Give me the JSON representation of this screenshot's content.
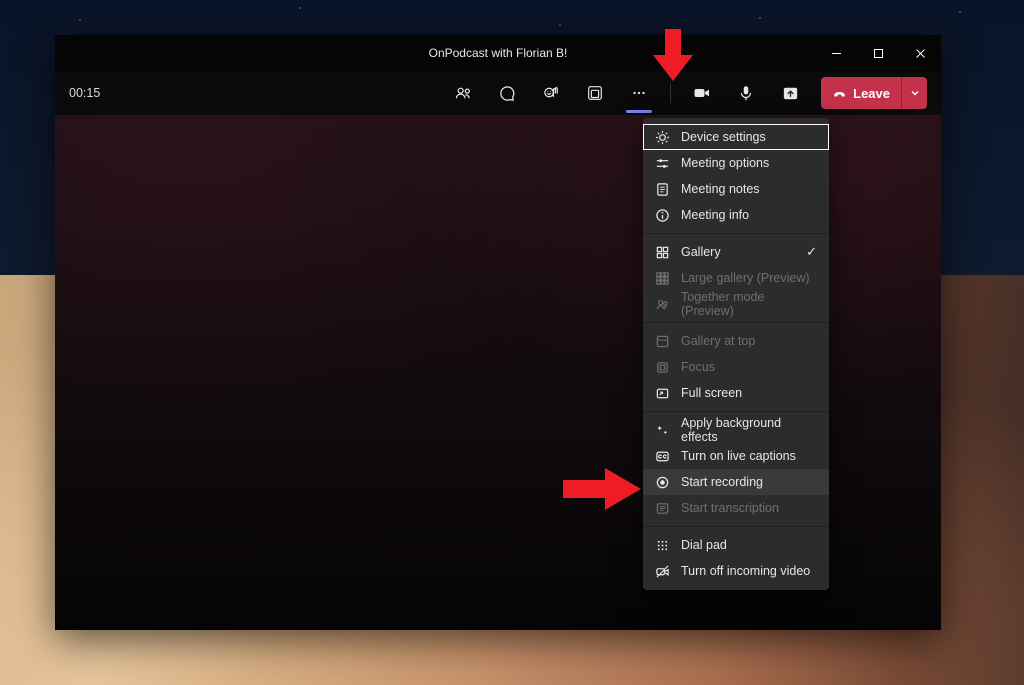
{
  "titlebar": {
    "title": "OnPodcast with Florian B!"
  },
  "toolbar": {
    "timer": "00:15",
    "leave_label": "Leave"
  },
  "menu": {
    "groups": [
      [
        {
          "key": "device_settings",
          "label": "Device settings",
          "icon": "gear",
          "selected": true
        },
        {
          "key": "meeting_options",
          "label": "Meeting options",
          "icon": "sliders"
        },
        {
          "key": "meeting_notes",
          "label": "Meeting notes",
          "icon": "notes"
        },
        {
          "key": "meeting_info",
          "label": "Meeting info",
          "icon": "info"
        }
      ],
      [
        {
          "key": "gallery",
          "label": "Gallery",
          "icon": "grid",
          "checked": true
        },
        {
          "key": "large_gallery",
          "label": "Large gallery (Preview)",
          "icon": "grid-large",
          "disabled": true
        },
        {
          "key": "together_mode",
          "label": "Together mode (Preview)",
          "icon": "people",
          "disabled": true
        }
      ],
      [
        {
          "key": "gallery_at_top",
          "label": "Gallery at top",
          "icon": "layout-top",
          "disabled": true
        },
        {
          "key": "focus",
          "label": "Focus",
          "icon": "frame",
          "disabled": true
        },
        {
          "key": "full_screen",
          "label": "Full screen",
          "icon": "fullscreen"
        }
      ],
      [
        {
          "key": "apply_bg",
          "label": "Apply background effects",
          "icon": "sparkle"
        },
        {
          "key": "live_captions",
          "label": "Turn on live captions",
          "icon": "cc"
        },
        {
          "key": "start_recording",
          "label": "Start recording",
          "icon": "record",
          "hover": true
        },
        {
          "key": "start_transcription",
          "label": "Start transcription",
          "icon": "transcript",
          "disabled": true
        }
      ],
      [
        {
          "key": "dial_pad",
          "label": "Dial pad",
          "icon": "dialpad"
        },
        {
          "key": "incoming_video_off",
          "label": "Turn off incoming video",
          "icon": "video-off"
        }
      ]
    ]
  }
}
